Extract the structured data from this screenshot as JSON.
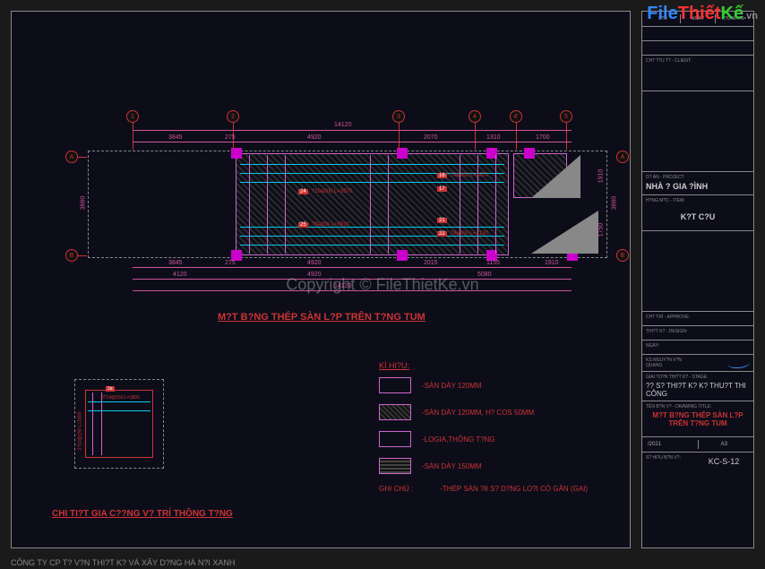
{
  "watermark": {
    "logo_file": "File",
    "logo_thiet": "Thiết",
    "logo_ke": "Kế",
    "logo_vn": ".vn",
    "copyright": "Copyright © FileThietKe.vn"
  },
  "footer": "CÔNG TY CP T? V?N THI?T K? VÀ XÂY D?NG HÀ N?I XANH",
  "title_block": {
    "header": {
      "c1": "L?N",
      "c2": "NGÀY",
      "c3": "X?C NH?N"
    },
    "chu_dau_tu_label": "CH? ??U T? - CLIENT:",
    "du_an_label": "D? ÁN - PROJECT:",
    "du_an": "NHÀ ? GIA ?ÌNH",
    "hang_muc_label": "H?NG M?C - ITEM:",
    "hang_muc": "K?T C?U",
    "chu_tri_label": "CH? TRÌ - APPROVE:",
    "thiet_ke_label": "THI?T K? - DESIGN:",
    "date_label": "NGÀY:",
    "ks_label": "KS.NGUY?N V?N QUANG",
    "giai_doan_label": "GIAI ?O?N THI?T K? - STAGE:",
    "giai_doan": "?? S? THI?T K? K? THU?T THI CÔNG",
    "ten_ban_ve_label": "TÊN B?N V? - DRAWING TITLE:",
    "ten_ban_ve": "M?T B?NG THÉP SÀN L?P TRÊN T?NG TUM",
    "ngay_thang": "/2021",
    "kho_giay": "A3",
    "so_hieu_label": "S? HI?U B?N V?:",
    "so_hieu": "KC-S-12"
  },
  "plan": {
    "title": "M?T B?NG THÉP SÀN L?P TRÊN T?NG TUM",
    "grids_x": [
      "1",
      "2",
      "3",
      "4",
      "4'",
      "5"
    ],
    "grids_y": [
      "A",
      "B"
    ],
    "dims_top_overall": "14120",
    "dims_top": [
      "3845",
      "275",
      "4920",
      "2070",
      "1310",
      "1700"
    ],
    "dims_bot": [
      "3845",
      "275",
      "4920",
      "2015",
      "1155",
      "1910"
    ],
    "dims_bot2": [
      "4120",
      "4920",
      "5080"
    ],
    "dims_bot_overall": "14120",
    "dims_right": [
      "1910",
      "1750"
    ],
    "dim_left": "3660",
    "dim_right_total": "3660",
    "rebar_labels": [
      "24",
      "16",
      "17",
      "25",
      "21",
      "22"
    ],
    "rebar_callouts": [
      "?10a200 L=3570",
      "?8a200 L=3910",
      "?8a200 L=2120",
      "?8a200 L=3570"
    ]
  },
  "detail": {
    "title": "CHI TI?T GIA C??NG V? TRÍ THÔNG T?NG",
    "callout1": "2?14@150 L=1800",
    "callout2": "2?14@150 L=1800",
    "num": "2a"
  },
  "legend": {
    "title": "KÍ HI?U:",
    "items": [
      {
        "text": "-SÀN DÀY 120MM"
      },
      {
        "text": "-SÀN DÀY 120MM, H? COS 50MM"
      },
      {
        "text": "-LOGIA,THÔNG T?NG"
      },
      {
        "text": "-SÀN DÀY 150MM"
      }
    ],
    "note_label": "GHI CHÚ  :",
    "note_text": "-THÉP SÀN ?8 S? D?NG LO?I CÓ GÂN (GAI)"
  }
}
